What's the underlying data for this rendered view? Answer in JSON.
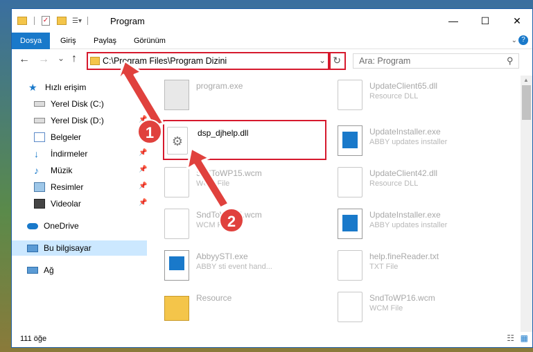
{
  "window": {
    "title": "Program",
    "minimize": "—",
    "maximize": "☐",
    "close": "✕"
  },
  "ribbon": {
    "tabs": [
      {
        "label": "Dosya"
      },
      {
        "label": "Giriş"
      },
      {
        "label": "Paylaş"
      },
      {
        "label": "Görünüm"
      }
    ],
    "help": "?"
  },
  "nav": {
    "back": "←",
    "forward": "→",
    "recent": "⌄",
    "up": "↑",
    "address": "C:\\Program Files\\Program Dizini",
    "refresh": "↻",
    "search_placeholder": "Ara: Program"
  },
  "sidebar": {
    "items": [
      {
        "label": "Hızlı erişim",
        "icon": "star-icon"
      },
      {
        "label": "Yerel Disk (C:)",
        "icon": "drive-icon"
      },
      {
        "label": "Yerel Disk (D:)",
        "icon": "drive-icon"
      },
      {
        "label": "Belgeler",
        "icon": "documents-icon"
      },
      {
        "label": "İndirmeler",
        "icon": "downloads-icon"
      },
      {
        "label": "Müzik",
        "icon": "music-icon"
      },
      {
        "label": "Resimler",
        "icon": "pictures-icon"
      },
      {
        "label": "Videolar",
        "icon": "videos-icon"
      },
      {
        "label": "OneDrive",
        "icon": "cloud-icon"
      },
      {
        "label": "Bu bilgisayar",
        "icon": "computer-icon"
      },
      {
        "label": "Ağ",
        "icon": "network-icon"
      }
    ]
  },
  "files": [
    {
      "name": "program.exe",
      "sub": ""
    },
    {
      "name": "UpdateClient65.dll",
      "sub": "Resource DLL"
    },
    {
      "name": "dsp_djhelp.dll",
      "sub": ""
    },
    {
      "name": "UpdateInstaller.exe",
      "sub": "ABBY updates installer"
    },
    {
      "name": "SndToWP15.wcm",
      "sub": "WCM File"
    },
    {
      "name": "UpdateClient42.dll",
      "sub": "Resource DLL"
    },
    {
      "name": "SndToWP14.wcm",
      "sub": "WCM File"
    },
    {
      "name": "UpdateInstaller.exe",
      "sub": "ABBY updates installer"
    },
    {
      "name": "AbbyySTI.exe",
      "sub": "ABBY sti event hand..."
    },
    {
      "name": "help.fineReader.txt",
      "sub": "TXT File"
    },
    {
      "name": "Resource",
      "sub": ""
    },
    {
      "name": "SndToWP16.wcm",
      "sub": "WCM File"
    }
  ],
  "status": {
    "count": "111 öğe"
  },
  "badges": {
    "one": "1",
    "two": "2"
  },
  "colors": {
    "accent": "#1979ca",
    "highlight": "#d6192d",
    "selected": "#cce8ff"
  }
}
